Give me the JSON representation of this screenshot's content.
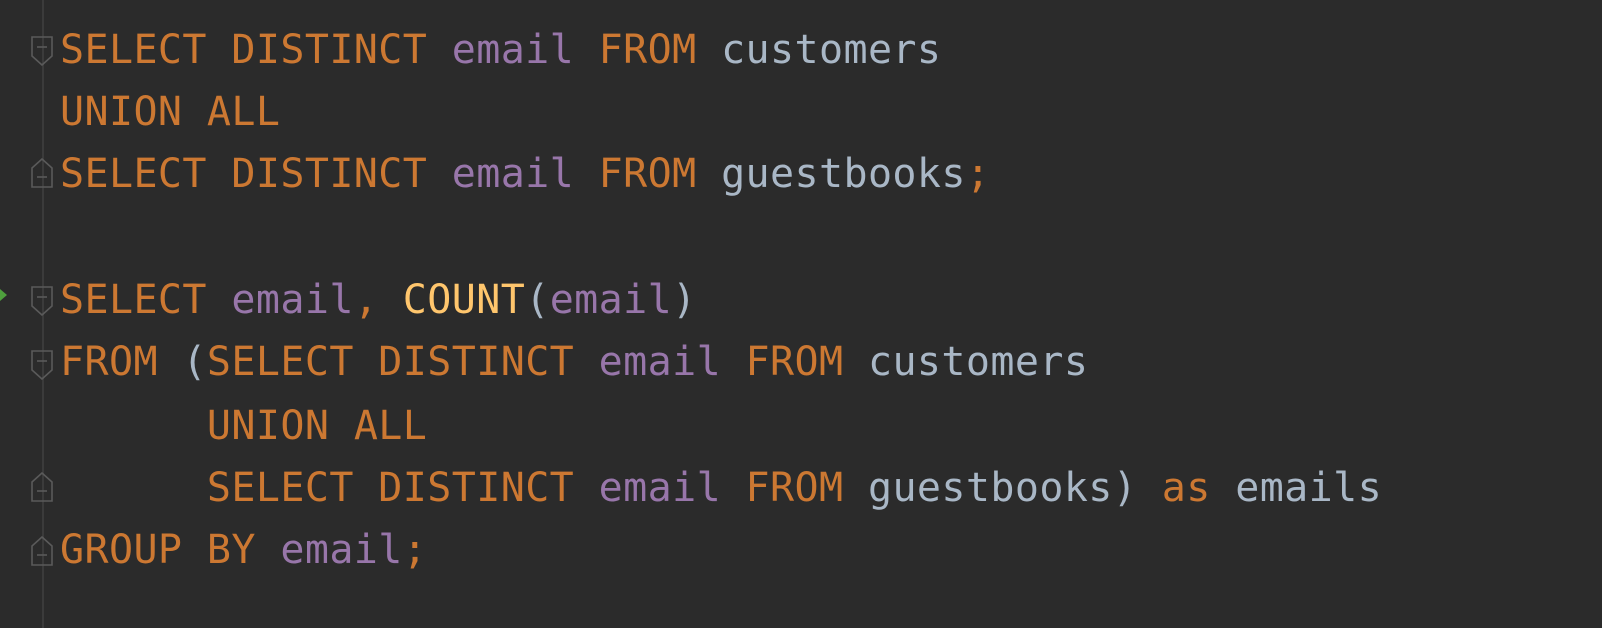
{
  "editor": {
    "colors": {
      "background": "#2b2b2b",
      "keyword": "#cc7832",
      "column": "#9876aa",
      "identifier": "#a9b7c6",
      "function": "#ffc66d",
      "run_marker": "#4e9f3d"
    },
    "icons": {
      "run": "run-arrow-icon",
      "fold_start": "fold-start-icon",
      "fold_end": "fold-end-icon"
    },
    "lines": [
      [
        {
          "t": "SELECT",
          "k": "kw"
        },
        {
          "t": " ",
          "k": "pn"
        },
        {
          "t": "DISTINCT",
          "k": "kw"
        },
        {
          "t": " ",
          "k": "pn"
        },
        {
          "t": "email",
          "k": "col"
        },
        {
          "t": " ",
          "k": "pn"
        },
        {
          "t": "FROM",
          "k": "kw"
        },
        {
          "t": " ",
          "k": "pn"
        },
        {
          "t": "customers",
          "k": "id"
        }
      ],
      [
        {
          "t": "UNION",
          "k": "kw"
        },
        {
          "t": " ",
          "k": "pn"
        },
        {
          "t": "ALL",
          "k": "kw"
        }
      ],
      [
        {
          "t": "SELECT",
          "k": "kw"
        },
        {
          "t": " ",
          "k": "pn"
        },
        {
          "t": "DISTINCT",
          "k": "kw"
        },
        {
          "t": " ",
          "k": "pn"
        },
        {
          "t": "email",
          "k": "col"
        },
        {
          "t": " ",
          "k": "pn"
        },
        {
          "t": "FROM",
          "k": "kw"
        },
        {
          "t": " ",
          "k": "pn"
        },
        {
          "t": "guestbooks",
          "k": "id"
        },
        {
          "t": ";",
          "k": "kw"
        }
      ],
      [],
      [
        {
          "t": "SELECT",
          "k": "kw"
        },
        {
          "t": " ",
          "k": "pn"
        },
        {
          "t": "email",
          "k": "col"
        },
        {
          "t": ",",
          "k": "kw"
        },
        {
          "t": " ",
          "k": "pn"
        },
        {
          "t": "COUNT",
          "k": "fn"
        },
        {
          "t": "(",
          "k": "pn"
        },
        {
          "t": "email",
          "k": "col"
        },
        {
          "t": ")",
          "k": "pn"
        }
      ],
      [
        {
          "t": "FROM",
          "k": "kw"
        },
        {
          "t": " ",
          "k": "pn"
        },
        {
          "t": "(",
          "k": "pn"
        },
        {
          "t": "SELECT",
          "k": "kw"
        },
        {
          "t": " ",
          "k": "pn"
        },
        {
          "t": "DISTINCT",
          "k": "kw"
        },
        {
          "t": " ",
          "k": "pn"
        },
        {
          "t": "email",
          "k": "col"
        },
        {
          "t": " ",
          "k": "pn"
        },
        {
          "t": "FROM",
          "k": "kw"
        },
        {
          "t": " ",
          "k": "pn"
        },
        {
          "t": "customers",
          "k": "id"
        }
      ],
      [
        {
          "t": "      ",
          "k": "pn"
        },
        {
          "t": "UNION",
          "k": "kw"
        },
        {
          "t": " ",
          "k": "pn"
        },
        {
          "t": "ALL",
          "k": "kw"
        }
      ],
      [
        {
          "t": "      ",
          "k": "pn"
        },
        {
          "t": "SELECT",
          "k": "kw"
        },
        {
          "t": " ",
          "k": "pn"
        },
        {
          "t": "DISTINCT",
          "k": "kw"
        },
        {
          "t": " ",
          "k": "pn"
        },
        {
          "t": "email",
          "k": "col"
        },
        {
          "t": " ",
          "k": "pn"
        },
        {
          "t": "FROM",
          "k": "kw"
        },
        {
          "t": " ",
          "k": "pn"
        },
        {
          "t": "guestbooks",
          "k": "id"
        },
        {
          "t": ")",
          "k": "pn"
        },
        {
          "t": " ",
          "k": "pn"
        },
        {
          "t": "as",
          "k": "kw"
        },
        {
          "t": " ",
          "k": "pn"
        },
        {
          "t": "emails",
          "k": "id"
        }
      ],
      [
        {
          "t": "GROUP",
          "k": "kw"
        },
        {
          "t": " ",
          "k": "pn"
        },
        {
          "t": "BY",
          "k": "kw"
        },
        {
          "t": " ",
          "k": "pn"
        },
        {
          "t": "email",
          "k": "col"
        },
        {
          "t": ";",
          "k": "kw"
        }
      ]
    ]
  }
}
